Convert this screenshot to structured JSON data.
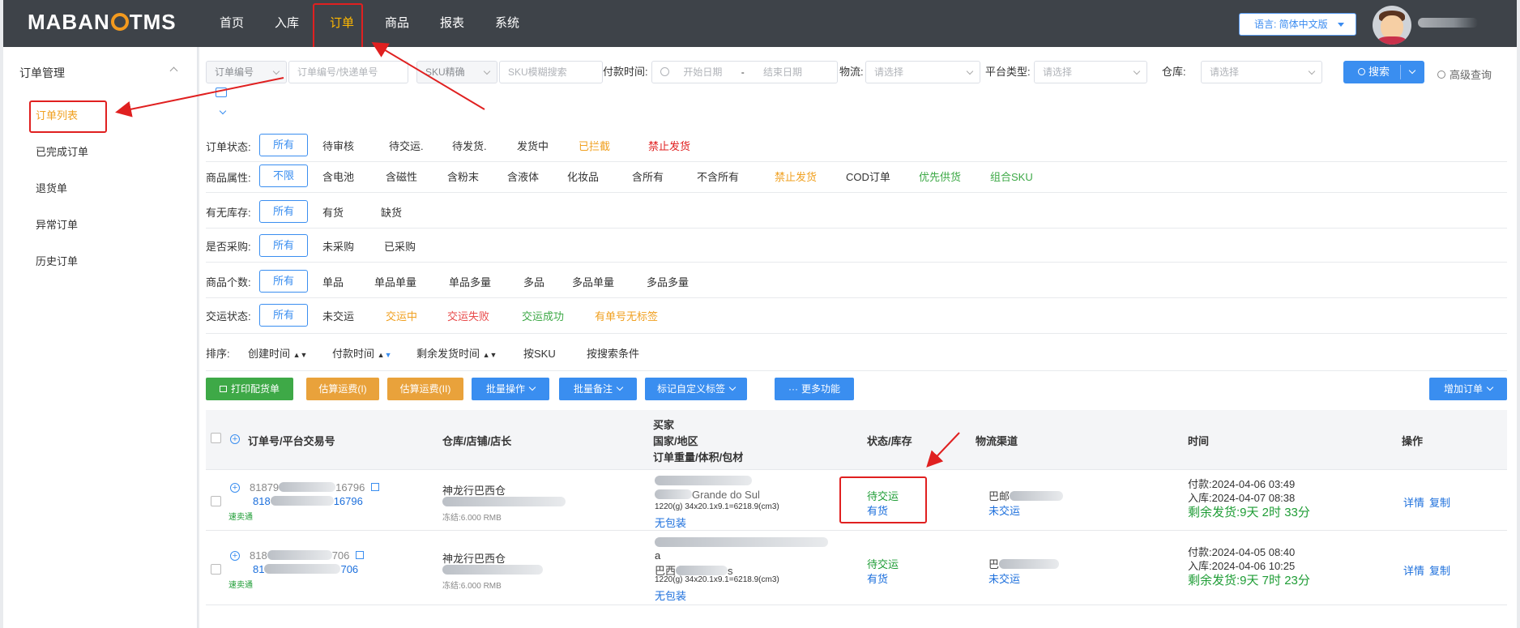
{
  "header": {
    "logo": "MABANG TMS",
    "nav": [
      "首页",
      "入库",
      "订单",
      "商品",
      "报表",
      "系统"
    ],
    "active_nav": "订单",
    "lang_label": "语言: 简体中文版"
  },
  "sidebar": {
    "title": "订单管理",
    "items": [
      "订单列表",
      "已完成订单",
      "退货单",
      "异常订单",
      "历史订单"
    ]
  },
  "search": {
    "order_select": "订单编号",
    "order_placeholder": "订单编号/快递单号",
    "sku_select": "SKU精确",
    "sku_placeholder": "SKU模糊搜索",
    "pay_time_label": "付款时间:",
    "start_date": "开始日期",
    "date_sep": "-",
    "end_date": "结束日期",
    "logistics_label": "物流:",
    "logistics_placeholder": "请选择",
    "platform_label": "平台类型:",
    "platform_placeholder": "请选择",
    "warehouse_label": "仓库:",
    "warehouse_placeholder": "请选择",
    "search_btn": "搜索",
    "advanced": "高级查询"
  },
  "filters": [
    {
      "name": "订单状态:",
      "options": [
        {
          "label": "所有",
          "selected": true
        },
        {
          "label": "待审核"
        },
        {
          "label": "待交运."
        },
        {
          "label": "待发货."
        },
        {
          "label": "发货中"
        },
        {
          "label": "已拦截",
          "color": "#f0a020"
        },
        {
          "label": "禁止发货",
          "color": "#e02020"
        }
      ]
    },
    {
      "name": "商品属性:",
      "options": [
        {
          "label": "不限",
          "selected": true
        },
        {
          "label": "含电池"
        },
        {
          "label": "含磁性"
        },
        {
          "label": "含粉末"
        },
        {
          "label": "含液体"
        },
        {
          "label": "化妆品"
        },
        {
          "label": "含所有"
        },
        {
          "label": "不含所有"
        },
        {
          "label": "禁止发货",
          "color": "#f0a020"
        },
        {
          "label": "COD订单"
        },
        {
          "label": "优先供货",
          "color": "#3ea947"
        },
        {
          "label": "组合SKU",
          "color": "#3ea947"
        }
      ]
    },
    {
      "name": "有无库存:",
      "options": [
        {
          "label": "所有",
          "selected": true
        },
        {
          "label": "有货"
        },
        {
          "label": "缺货"
        }
      ]
    },
    {
      "name": "是否采购:",
      "options": [
        {
          "label": "所有",
          "selected": true
        },
        {
          "label": "未采购"
        },
        {
          "label": "已采购"
        }
      ]
    },
    {
      "name": "商品个数:",
      "options": [
        {
          "label": "所有",
          "selected": true
        },
        {
          "label": "单品"
        },
        {
          "label": "单品单量"
        },
        {
          "label": "单品多量"
        },
        {
          "label": "多品"
        },
        {
          "label": "多品单量"
        },
        {
          "label": "多品多量"
        }
      ]
    },
    {
      "name": "交运状态:",
      "options": [
        {
          "label": "所有",
          "selected": true
        },
        {
          "label": "未交运"
        },
        {
          "label": "交运中",
          "color": "#f0a020"
        },
        {
          "label": "交运失败",
          "color": "#e84a4a"
        },
        {
          "label": "交运成功",
          "color": "#3ea947"
        },
        {
          "label": "有单号无标签",
          "color": "#f0a020"
        }
      ]
    }
  ],
  "sort": {
    "label": "排序:",
    "options": [
      "创建时间",
      "付款时间",
      "剩余发货时间",
      "按SKU",
      "按搜索条件"
    ]
  },
  "actions": {
    "print": "打印配货单",
    "estimate1": "估算运费(I)",
    "estimate2": "估算运费(II)",
    "batch_op": "批量操作",
    "batch_note": "批量备注",
    "custom_tag": "标记自定义标签",
    "more": "更多功能",
    "add_order": "增加订单"
  },
  "table": {
    "headers": {
      "order": "订单号/平台交易号",
      "warehouse": "仓库/店铺/店长",
      "buyer1": "买家",
      "buyer2": "国家/地区",
      "buyer3": "订单重量/体积/包材",
      "status": "状态/库存",
      "logistics": "物流渠道",
      "time": "时间",
      "ops": "操作"
    },
    "rows": [
      {
        "order_no": "81879",
        "order_tail": "16796",
        "platform_prefix": "818",
        "platform_tail": "16796",
        "channel": "速卖通",
        "warehouse": "神龙行巴西仓",
        "frozen": "冻结:6.000 RMB",
        "buyer_region": "Grande do Sul",
        "weight": "1220(g) 34x20.1x9.1=6218.9(cm3)",
        "pack": "无包装",
        "status": "待交运",
        "stock": "有货",
        "logistics_prefix": "巴邮",
        "logistics_status": "未交运",
        "pay_time": "付款:2024-04-06 03:49",
        "in_time": "入库:2024-04-07 08:38",
        "remain": "剩余发货:9天 2时 33分",
        "op_detail": "详情",
        "op_copy": "复制"
      },
      {
        "order_no": "818",
        "order_tail": "706",
        "platform_prefix": "81",
        "platform_tail": "706",
        "channel": "速卖通",
        "warehouse": "神龙行巴西仓",
        "frozen": "冻结:6.000 RMB",
        "buyer_line2": "a",
        "buyer_region_prefix": "巴西",
        "buyer_region": "s",
        "weight": "1220(g) 34x20.1x9.1=6218.9(cm3)",
        "pack": "无包装",
        "status": "待交运",
        "stock": "有货",
        "logistics_prefix": "巴",
        "logistics_status": "未交运",
        "pay_time": "付款:2024-04-05 08:40",
        "in_time": "入库:2024-04-06 10:25",
        "remain": "剩余发货:9天 7时 23分",
        "op_detail": "详情",
        "op_copy": "复制"
      }
    ]
  }
}
